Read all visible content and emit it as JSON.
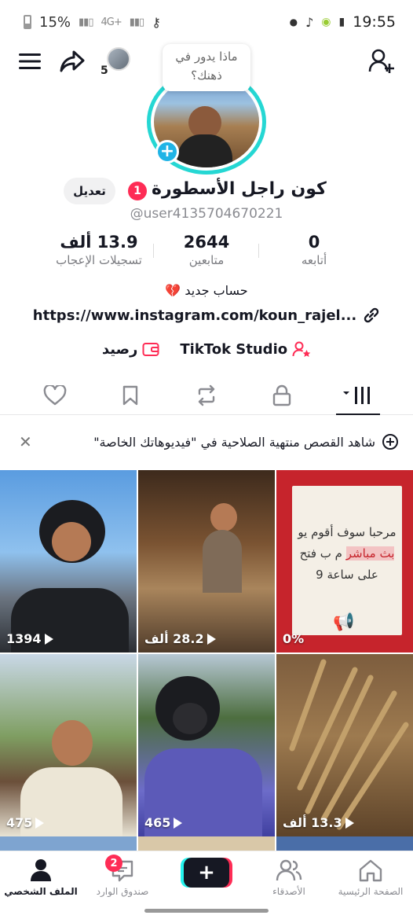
{
  "status_bar": {
    "battery": "15%",
    "network": "4G+",
    "time": "19:55"
  },
  "top_bar": {
    "story_count": "5"
  },
  "thought_bubble": "ماذا يدور في ذهنك؟",
  "profile": {
    "display_name": "كون راجل الأسطورة",
    "notification_count": "1",
    "edit_label": "تعديل",
    "username": "@user4135704670221"
  },
  "stats": {
    "following": {
      "value": "0",
      "label": "أتابعه"
    },
    "followers": {
      "value": "2644",
      "label": "متابعين"
    },
    "likes": {
      "value": "13.9 ألف",
      "label": "تسجيلات الإعجاب"
    }
  },
  "bio": {
    "text": "حساب جديد 💔",
    "link": "https://www.instagram.com/koun_rajel..."
  },
  "tools": {
    "studio": "TikTok Studio",
    "balance": "رصيد"
  },
  "banner": {
    "text": "شاهد القصص منتهية الصلاحية في \"فيديوهاتك الخاصة\""
  },
  "videos": [
    {
      "count": "0%",
      "caption_lines": [
        "مرحبا سوف أقوم يو",
        "م ب فتح بث مباشر",
        "على ساعة 9"
      ],
      "highlight": "بث مباشر"
    },
    {
      "count": "28.2 ألف"
    },
    {
      "count": "1394"
    },
    {
      "count": "13.3 ألف"
    },
    {
      "count": "465"
    },
    {
      "count": "475"
    }
  ],
  "bottom_nav": {
    "home": "الصفحة الرئيسية",
    "friends": "الأصدقاء",
    "inbox": "صندوق الوارد",
    "inbox_badge": "2",
    "profile": "الملف الشخصي"
  },
  "colors": {
    "accent_red": "#fe2c55",
    "ring_cyan": "#25d7d3",
    "plus_blue": "#20b4e6"
  }
}
